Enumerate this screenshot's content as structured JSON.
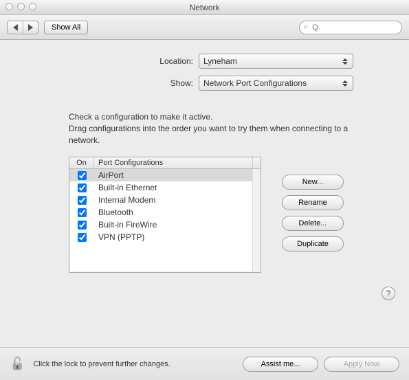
{
  "window": {
    "title": "Network"
  },
  "toolbar": {
    "show_all": "Show All",
    "search_placeholder": "Q"
  },
  "form": {
    "location_label": "Location:",
    "location_value": "Lyneham",
    "show_label": "Show:",
    "show_value": "Network Port Configurations"
  },
  "instructions": {
    "line1": "Check a configuration to make it active.",
    "line2": "Drag configurations into the order you want to try them when connecting to a network."
  },
  "table": {
    "col_on": "On",
    "col_name": "Port Configurations",
    "rows": [
      {
        "on": true,
        "name": "AirPort",
        "selected": true
      },
      {
        "on": true,
        "name": "Built-in Ethernet",
        "selected": false
      },
      {
        "on": true,
        "name": "Internal Modem",
        "selected": false
      },
      {
        "on": true,
        "name": "Bluetooth",
        "selected": false
      },
      {
        "on": true,
        "name": "Built-in FireWire",
        "selected": false
      },
      {
        "on": true,
        "name": "VPN (PPTP)",
        "selected": false
      }
    ]
  },
  "side_buttons": {
    "new": "New...",
    "rename": "Rename",
    "delete": "Delete...",
    "duplicate": "Duplicate"
  },
  "help": {
    "label": "?"
  },
  "footer": {
    "lock_text": "Click the lock to prevent further changes.",
    "assist": "Assist me...",
    "apply": "Apply Now",
    "apply_enabled": false
  }
}
